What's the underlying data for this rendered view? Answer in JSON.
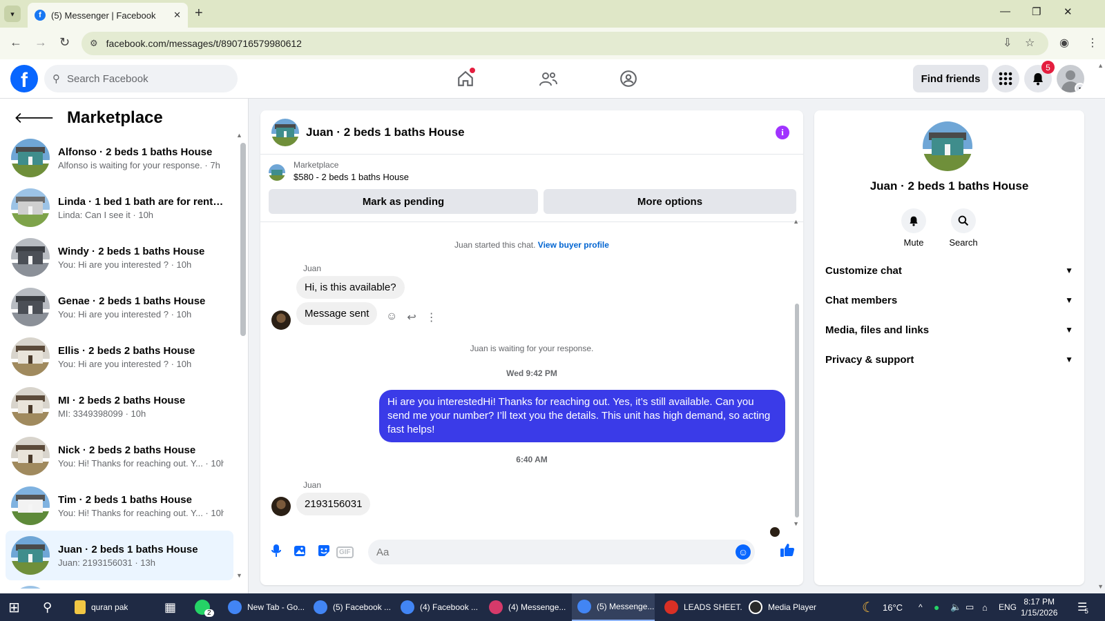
{
  "browser": {
    "tab_title": "(5) Messenger | Facebook",
    "tab_favicon": "facebook-icon",
    "url": "facebook.com/messages/t/890716579980612"
  },
  "header": {
    "search_placeholder": "Search Facebook",
    "find_friends": "Find friends",
    "notification_count": "5"
  },
  "sidebar": {
    "title": "Marketplace",
    "conversations": [
      {
        "title": "Alfonso · 2 beds 1 baths House",
        "sub": "Alfonso is waiting for your response. · 7h"
      },
      {
        "title": "Linda · 1 bed 1 bath are for rent ...",
        "sub": "Linda: Can I see it · 10h"
      },
      {
        "title": "Windy · 2 beds 1 baths House",
        "sub": "You: Hi are you interested ? · 10h"
      },
      {
        "title": "Genae · 2 beds 1 baths House",
        "sub": "You: Hi are you interested ? · 10h"
      },
      {
        "title": "Ellis · 2 beds 2 baths House",
        "sub": "You: Hi are you interested ? · 10h"
      },
      {
        "title": "MI · 2 beds 2 baths House",
        "sub": "MI: 3349398099 · 10h"
      },
      {
        "title": "Nick · 2 beds 2 baths House",
        "sub": "You: Hi! Thanks for reaching out. Y... · 10h"
      },
      {
        "title": "Tim · 2 beds 1 baths House",
        "sub": "You: Hi! Thanks for reaching out. Y... · 10h"
      },
      {
        "title": "Juan · 2 beds 1 baths House",
        "sub": "Juan: 2193156031 · 13h"
      }
    ]
  },
  "chat": {
    "title": "Juan · 2 beds 1 baths House",
    "listing_source": "Marketplace",
    "listing_price_title": "$580 - 2 beds 1 baths House",
    "mark_pending": "Mark as pending",
    "more_options": "More options",
    "started_text": "Juan started this chat.",
    "view_profile": "View buyer profile",
    "sender_name_1": "Juan",
    "msg_1": "Hi, is this available?",
    "msg_2": "Message sent",
    "waiting_text": "Juan is waiting for your response.",
    "timestamp_1": "Wed 9:42 PM",
    "msg_out": "Hi are you interestedHi! Thanks for reaching out. Yes, it’s still available. Can you send me your number? I’ll text you the details. This unit has high demand, so acting fast helps!",
    "timestamp_2": "6:40 AM",
    "sender_name_2": "Juan",
    "msg_3": "2193156031",
    "input_placeholder": "Aa"
  },
  "info_panel": {
    "name": "Juan · 2 beds 1 baths House",
    "mute": "Mute",
    "search": "Search",
    "sections": [
      "Customize chat",
      "Chat members",
      "Media, files and links",
      "Privacy & support"
    ]
  },
  "taskbar": {
    "items": [
      {
        "label": "quran pak",
        "color": "#f2c744"
      },
      {
        "label": "New Tab - Go...",
        "color": "#4285f4"
      },
      {
        "label": "(5) Facebook ...",
        "color": "#4285f4"
      },
      {
        "label": "(4) Facebook ...",
        "color": "#4285f4"
      },
      {
        "label": "(4) Messenge...",
        "color": "#d63a6a"
      },
      {
        "label": "(5) Messenge...",
        "color": "#4285f4"
      },
      {
        "label": "LEADS SHEET...",
        "color": "#d93025"
      },
      {
        "label": "Media Player",
        "color": "#ffffff"
      }
    ],
    "whatsapp_badge": "2",
    "temperature": "16°C",
    "language": "ENG",
    "time": "8:17 PM",
    "date": "1/15/2026",
    "notification_badge": "5"
  },
  "colors": {
    "fb_blue": "#0866ff",
    "outgoing_bubble": "#3a3be8",
    "badge_red": "#e41e3f",
    "info_purple": "#a033ff"
  }
}
